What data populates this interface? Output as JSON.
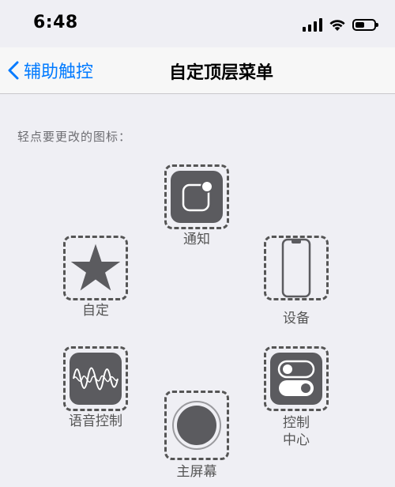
{
  "status_bar": {
    "time": "6:48"
  },
  "nav": {
    "back_label": "辅助触控",
    "title": "自定顶层菜单"
  },
  "hint": "轻点要更改的图标：",
  "menu": {
    "notifications": {
      "label": "通知"
    },
    "custom": {
      "label": "自定"
    },
    "device": {
      "label": "设备"
    },
    "voice_control": {
      "label": "语音控制"
    },
    "control_center": {
      "label_line1": "控制",
      "label_line2": "中心"
    },
    "home": {
      "label": "主屏幕"
    }
  },
  "colors": {
    "accent": "#007aff",
    "tile": "#5b5b5f",
    "background": "#efeff4"
  }
}
